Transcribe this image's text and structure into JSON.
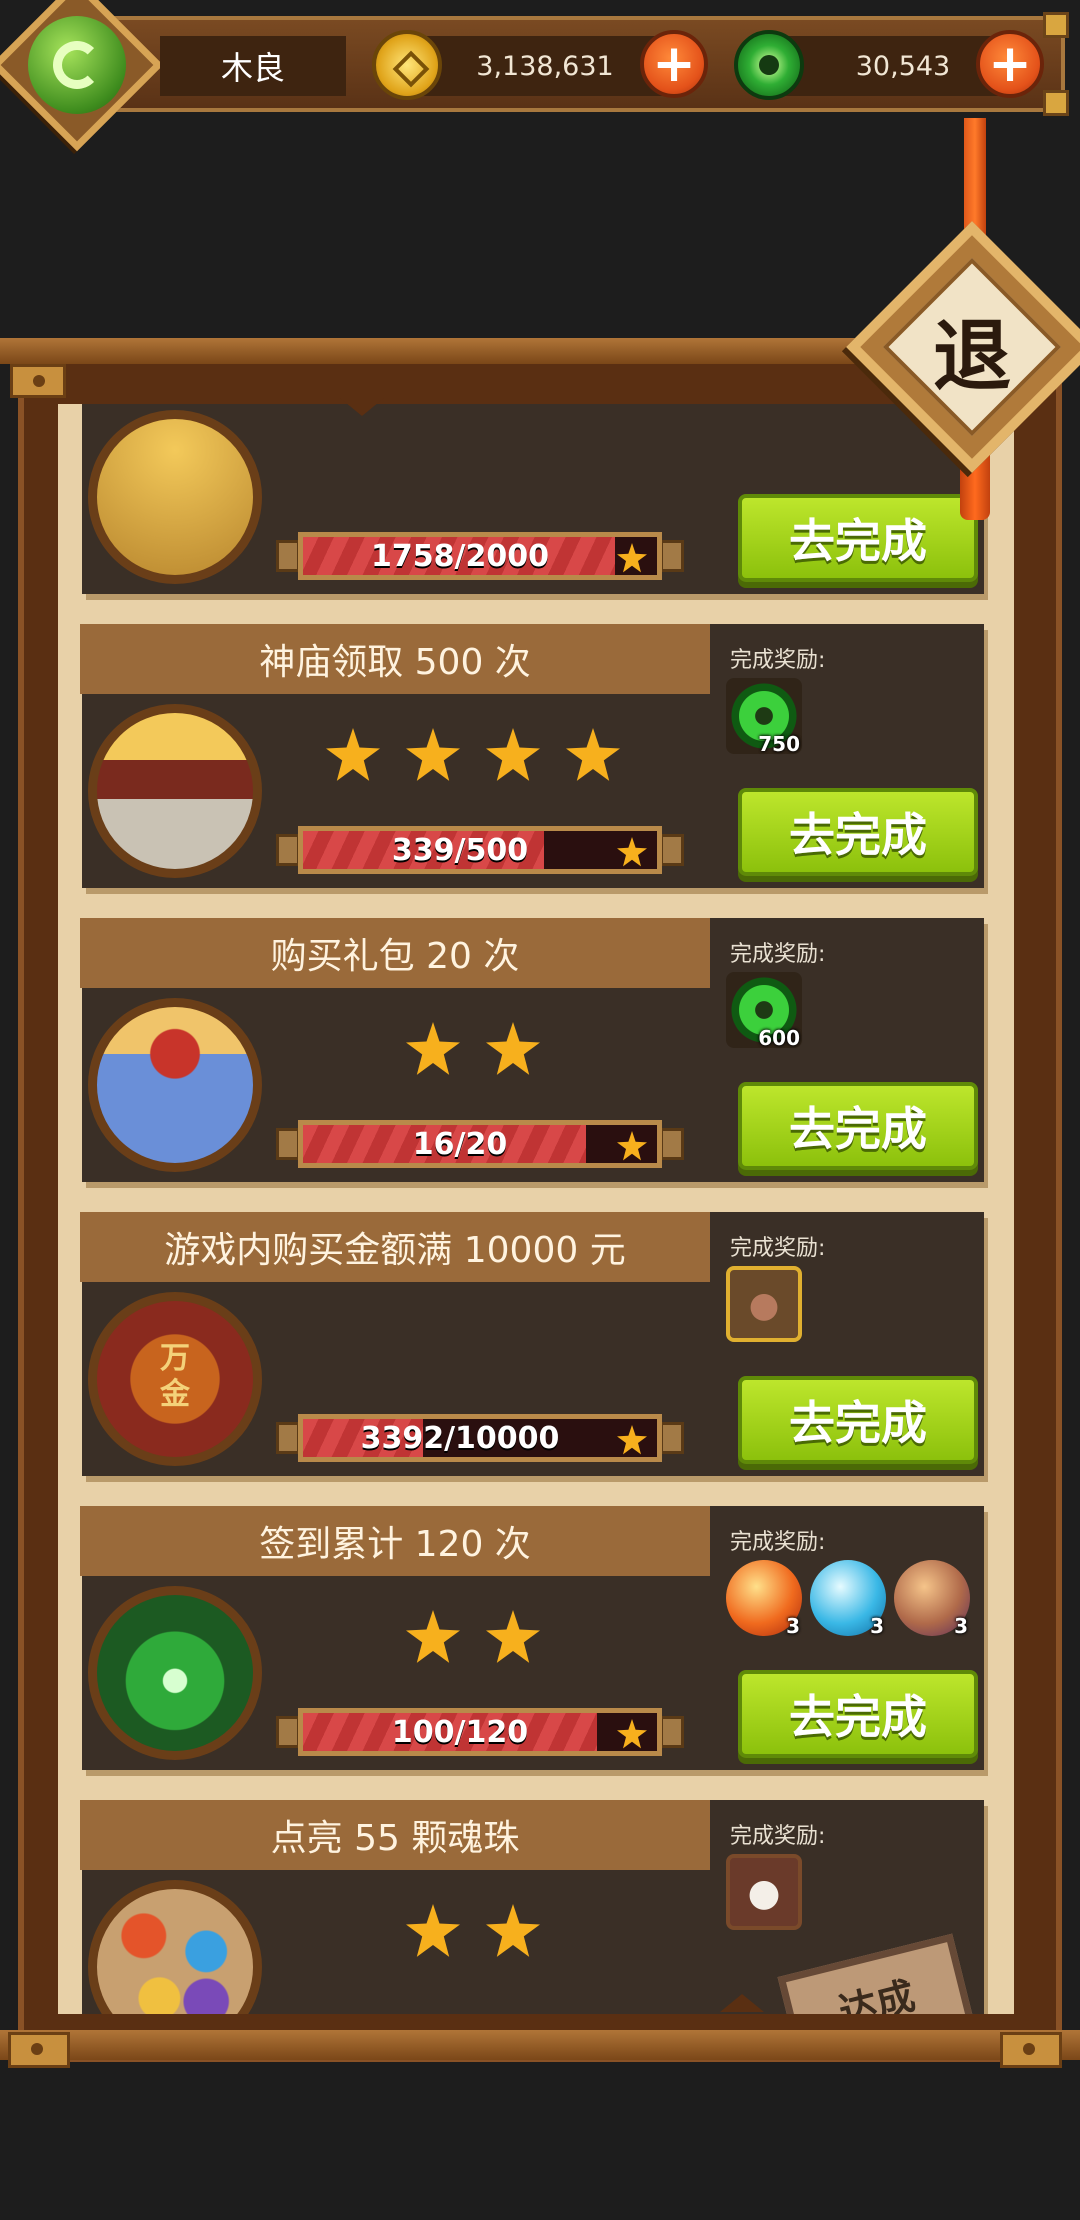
{
  "hud": {
    "player_name": "木良",
    "gold_amount": "3,138,631",
    "jade_amount": "30,543",
    "add_label": "+"
  },
  "exit_label": "退",
  "reward_label": "完成奖励:",
  "complete_button_label": "去完成",
  "achieved_stamp_label": "达成",
  "tasks": [
    {
      "title": "",
      "stars": 0,
      "progress_text": "1758/2000",
      "progress": 0.879,
      "rewards": [],
      "status": "in_progress",
      "icon": "partial-task-icon"
    },
    {
      "title": "神庙领取 500 次",
      "stars": 4,
      "progress_text": "339/500",
      "progress": 0.678,
      "rewards": [
        {
          "icon": "jade-icon",
          "count": "750"
        }
      ],
      "status": "in_progress",
      "icon": "temple-icon"
    },
    {
      "title": "购买礼包 20 次",
      "stars": 2,
      "progress_text": "16/20",
      "progress": 0.8,
      "rewards": [
        {
          "icon": "jade-icon",
          "count": "600"
        }
      ],
      "status": "in_progress",
      "icon": "gift-box-icon"
    },
    {
      "title": "游戏内购买金额满 10000 元",
      "stars": 0,
      "progress_text": "3392/10000",
      "progress": 0.339,
      "rewards": [
        {
          "icon": "pig-card-icon",
          "count": ""
        }
      ],
      "status": "in_progress",
      "icon": "scroll-icon",
      "icon_text": "万金"
    },
    {
      "title": "签到累计 120 次",
      "stars": 2,
      "progress_text": "100/120",
      "progress": 0.833,
      "rewards": [
        {
          "icon": "fire-orb-icon",
          "count": "3"
        },
        {
          "icon": "water-orb-icon",
          "count": "3"
        },
        {
          "icon": "earth-orb-icon",
          "count": "3"
        }
      ],
      "status": "in_progress",
      "icon": "shrine-icon"
    },
    {
      "title": "点亮 55 颗魂珠",
      "stars": 2,
      "progress_text": "",
      "progress": 1,
      "rewards": [
        {
          "icon": "heart-card-icon",
          "count": ""
        }
      ],
      "status": "achieved",
      "icon": "soul-orbs-icon"
    }
  ]
}
